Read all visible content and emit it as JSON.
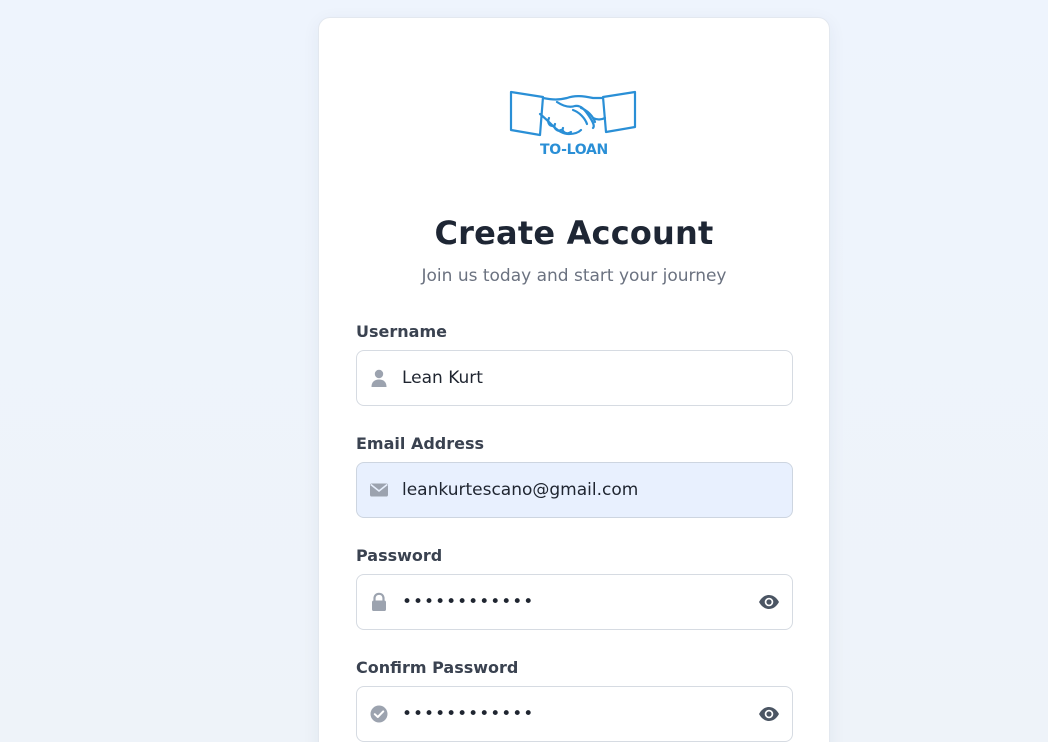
{
  "brand": {
    "logo_text": "TO-LOAN",
    "color": "#2a8fd6"
  },
  "header": {
    "title": "Create Account",
    "subtitle": "Join us today and start your journey"
  },
  "form": {
    "username": {
      "label": "Username",
      "value": "Lean Kurt",
      "icon": "user-icon"
    },
    "email": {
      "label": "Email Address",
      "value": "leankurtescano@gmail.com",
      "icon": "envelope-icon"
    },
    "password": {
      "label": "Password",
      "value": "••••••••••••",
      "icon": "lock-icon",
      "toggle_icon": "eye-icon"
    },
    "confirm_password": {
      "label": "Confirm Password",
      "value": "••••••••••••",
      "icon": "check-circle-icon",
      "toggle_icon": "eye-icon"
    }
  },
  "colors": {
    "icon_gray": "#9ca3af",
    "eye_gray": "#4b5563",
    "autofill_bg": "#e8f0fe"
  }
}
